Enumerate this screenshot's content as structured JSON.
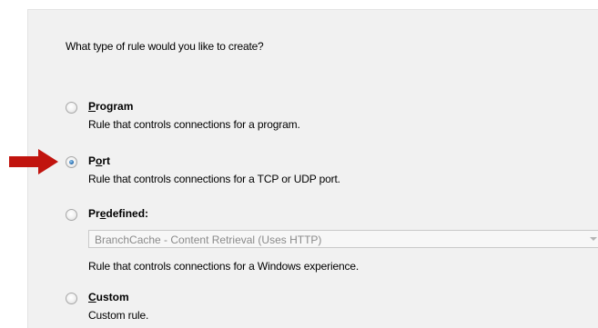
{
  "question": "What type of rule would you like to create?",
  "options": [
    {
      "accel": "P",
      "rest": "rogram",
      "desc": "Rule that controls connections for a program.",
      "checked": false
    },
    {
      "pre": "P",
      "accel": "o",
      "rest": "rt",
      "desc": "Rule that controls connections for a TCP or UDP port.",
      "checked": true
    },
    {
      "pre": "Pr",
      "accel": "e",
      "rest": "defined:",
      "desc": "Rule that controls connections for a Windows experience.",
      "checked": false
    },
    {
      "accel": "C",
      "rest": "ustom",
      "desc": "Custom rule.",
      "checked": false
    }
  ],
  "predefined_dropdown": {
    "selected": "BranchCache - Content Retrieval (Uses HTTP)"
  },
  "annotation": {
    "arrow_color": "#c1140e",
    "icon": "red-arrow-pointer-icon"
  }
}
